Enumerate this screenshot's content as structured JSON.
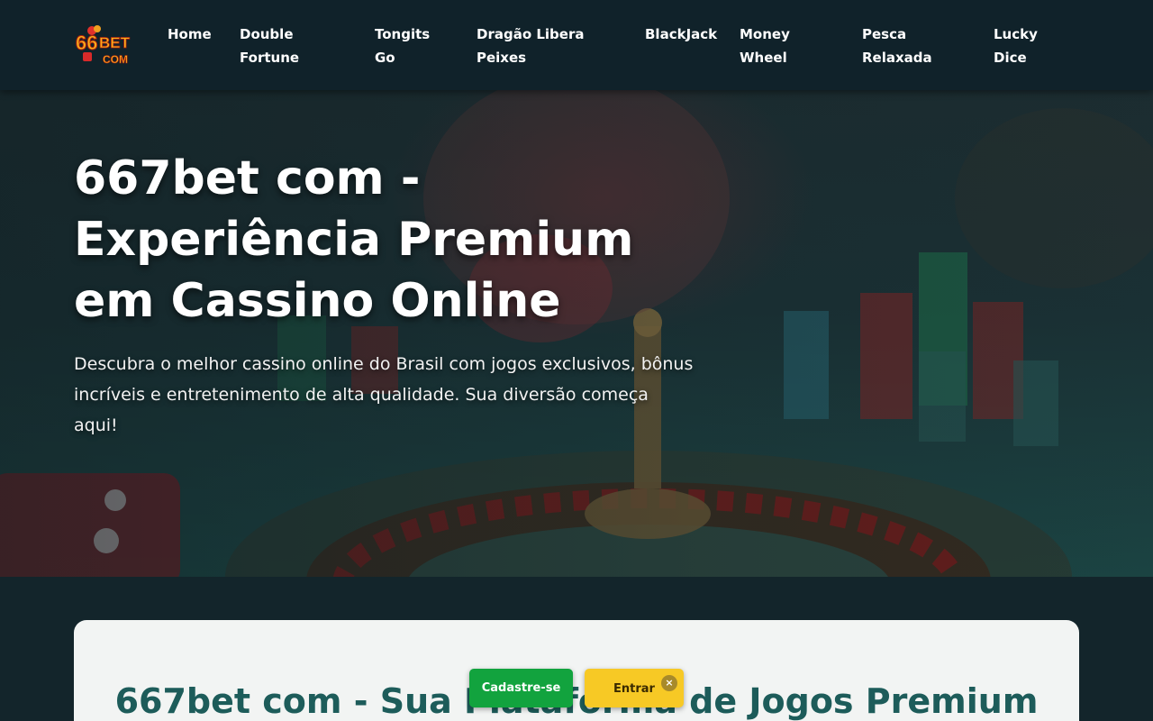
{
  "header": {
    "logo_text": "66BET.COM",
    "nav": [
      {
        "label": "Home"
      },
      {
        "label": "Double Fortune"
      },
      {
        "label": "Tongits Go"
      },
      {
        "label": "Dragão Libera Peixes"
      },
      {
        "label": "BlackJack"
      },
      {
        "label": "Money Wheel"
      },
      {
        "label": "Pesca Relaxada"
      },
      {
        "label": "Lucky Dice"
      }
    ]
  },
  "hero": {
    "title": "667bet com - Experiência Premium em Cassino Online",
    "description": "Descubra o melhor cassino online do Brasil com jogos exclusivos, bônus incríveis e entretenimento de alta qualidade. Sua diversão começa aqui!"
  },
  "section": {
    "title": "667bet com - Sua Plataforma de Jogos Premium"
  },
  "floating": {
    "signup_label": "Cadastre-se",
    "login_label": "Entrar",
    "close_label": "×"
  },
  "colors": {
    "header_bg": "#10222a",
    "signup_green": "#12a33e",
    "login_yellow": "#f7c925",
    "section_title_teal": "#1d5c5a",
    "card_bg": "#f2f4f3"
  }
}
